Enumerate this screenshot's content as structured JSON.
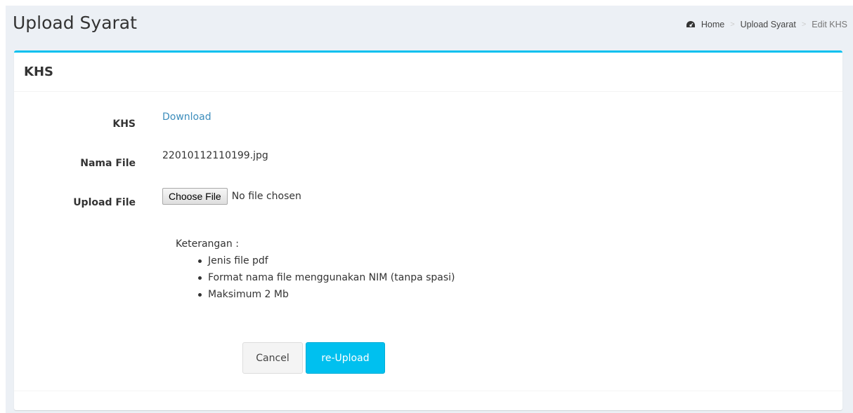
{
  "header": {
    "title": "Upload Syarat",
    "breadcrumb": [
      {
        "label": "Home",
        "icon": "dashboard-icon"
      },
      {
        "label": "Upload Syarat"
      },
      {
        "label": "Edit KHS"
      }
    ],
    "separator": ">"
  },
  "box": {
    "title": "KHS",
    "accent_color": "#00c0ef",
    "fields": [
      {
        "label": "KHS",
        "value": "Download"
      },
      {
        "label": "Nama File",
        "value": "22010112110199.jpg"
      },
      {
        "label": "Upload File",
        "button_label": "Choose File",
        "status": "No file chosen"
      }
    ],
    "notes": {
      "heading": "Keterangan :",
      "items": [
        "Jenis file pdf",
        "Format nama file menggunakan NIM (tanpa spasi)",
        "Maksimum 2 Mb"
      ]
    },
    "actions": {
      "cancel_label": "Cancel",
      "submit_label": "re-Upload"
    }
  }
}
